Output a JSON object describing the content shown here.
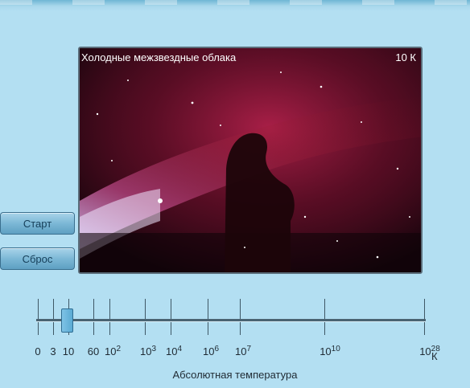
{
  "viewer": {
    "caption": "Холодные межзвездные облака",
    "temperature": "10 К"
  },
  "buttons": {
    "start": "Старт",
    "reset": "Сброс"
  },
  "slider": {
    "unit": "К",
    "title": "Абсолютная температура",
    "selected_label_index": 2,
    "tick_labels": [
      {
        "base": "0",
        "exp": ""
      },
      {
        "base": "3",
        "exp": ""
      },
      {
        "base": "10",
        "exp": ""
      },
      {
        "base": "60",
        "exp": ""
      },
      {
        "base": "10",
        "exp": "2"
      },
      {
        "base": "10",
        "exp": "3"
      },
      {
        "base": "10",
        "exp": "4"
      },
      {
        "base": "10",
        "exp": "6"
      },
      {
        "base": "10",
        "exp": "7"
      },
      {
        "base": "10",
        "exp": "10"
      },
      {
        "base": "10",
        "exp": "28"
      }
    ]
  }
}
